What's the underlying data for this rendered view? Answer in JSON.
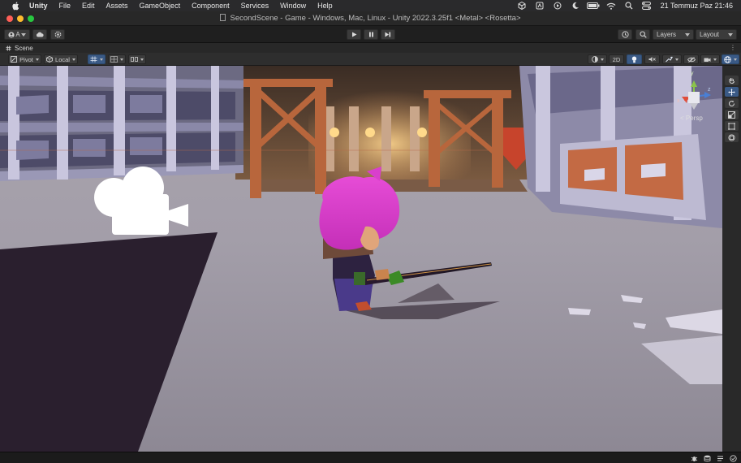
{
  "menubar": {
    "app_name": "Unity",
    "items": [
      "File",
      "Edit",
      "Assets",
      "GameObject",
      "Component",
      "Services",
      "Window",
      "Help"
    ],
    "clock": "21 Temmuz Paz  21:46"
  },
  "window": {
    "title": "SecondScene - Game - Windows, Mac, Linux - Unity 2022.3.25f1 <Metal> <Rosetta>"
  },
  "toolbar": {
    "account_label": "A",
    "layers_label": "Layers",
    "layout_label": "Layout"
  },
  "scene_tab": {
    "label": "Scene"
  },
  "scene_toolbar": {
    "pivot_label": "Pivot",
    "local_label": "Local",
    "mode_2d_label": "2D"
  },
  "viewport": {
    "projection_label": "< Persp",
    "gizmo_axis_y": "y",
    "gizmo_axis_z": "z",
    "gizmo_axis_x": "x"
  },
  "colors": {
    "accent": "#3a5a86",
    "traffic_red": "#ff5f57",
    "traffic_yellow": "#febc2e",
    "traffic_green": "#28c840"
  }
}
